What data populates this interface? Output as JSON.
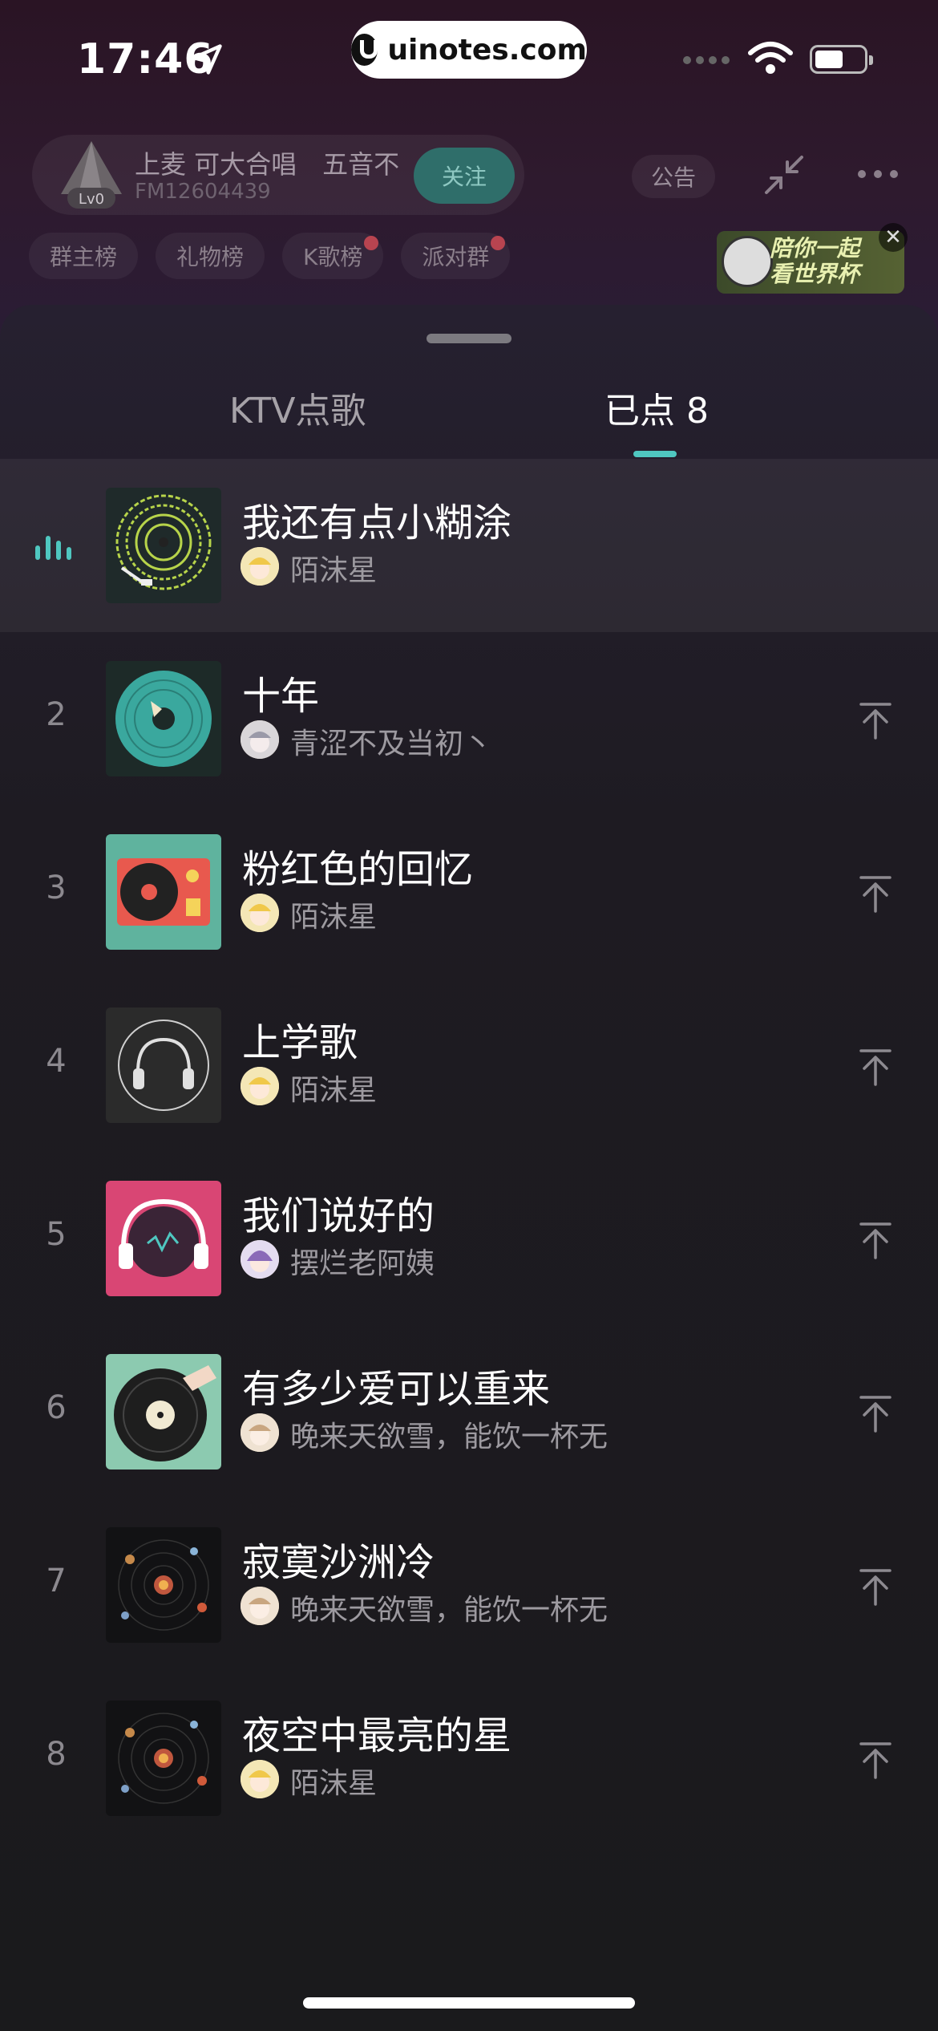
{
  "status_bar": {
    "time": "17:46",
    "url": "uinotes.com",
    "icons": [
      "location-arrow-icon",
      "cellular-signal-icon",
      "wifi-icon",
      "battery-icon"
    ]
  },
  "room": {
    "name": "上麦 可大合唱　五音不",
    "id": "FM12604439",
    "level_badge": "Lv0",
    "follow_label": "关注",
    "notice_label": "公告",
    "rank_tags": [
      {
        "label": "群主榜",
        "dot": false
      },
      {
        "label": "礼物榜",
        "dot": false
      },
      {
        "label": "K歌榜",
        "dot": true
      },
      {
        "label": "派对群",
        "dot": true
      }
    ],
    "promo_text_line1": "陪你一起",
    "promo_text_line2": "看世界杯"
  },
  "sheet": {
    "tabs": [
      {
        "label": "KTV点歌",
        "active": false
      },
      {
        "label": "已点 8",
        "active": true
      }
    ],
    "songs": [
      {
        "index": "",
        "title": "我还有点小糊涂",
        "user": "陌沫星",
        "playing": true,
        "cover": "green-wave-vinyl"
      },
      {
        "index": "2",
        "title": "十年",
        "user": "青涩不及当初丶",
        "playing": false,
        "cover": "teal-vinyl"
      },
      {
        "index": "3",
        "title": "粉红色的回忆",
        "user": "陌沫星",
        "playing": false,
        "cover": "turntable"
      },
      {
        "index": "4",
        "title": "上学歌",
        "user": "陌沫星",
        "playing": false,
        "cover": "headphones-dark"
      },
      {
        "index": "5",
        "title": "我们说好的",
        "user": "摆烂老阿姨",
        "playing": false,
        "cover": "headphones-pink"
      },
      {
        "index": "6",
        "title": "有多少爱可以重来",
        "user": "晚来天欲雪，能饮一杯无",
        "playing": false,
        "cover": "hand-vinyl"
      },
      {
        "index": "7",
        "title": "寂寞沙洲冷",
        "user": "晚来天欲雪，能饮一杯无",
        "playing": false,
        "cover": "solar-system"
      },
      {
        "index": "8",
        "title": "夜空中最亮的星",
        "user": "陌沫星",
        "playing": false,
        "cover": "solar-system"
      }
    ]
  },
  "colors": {
    "accent": "#4fc7c0",
    "background": "#1a1a1c",
    "secondary_text": "#9d9aa0"
  }
}
